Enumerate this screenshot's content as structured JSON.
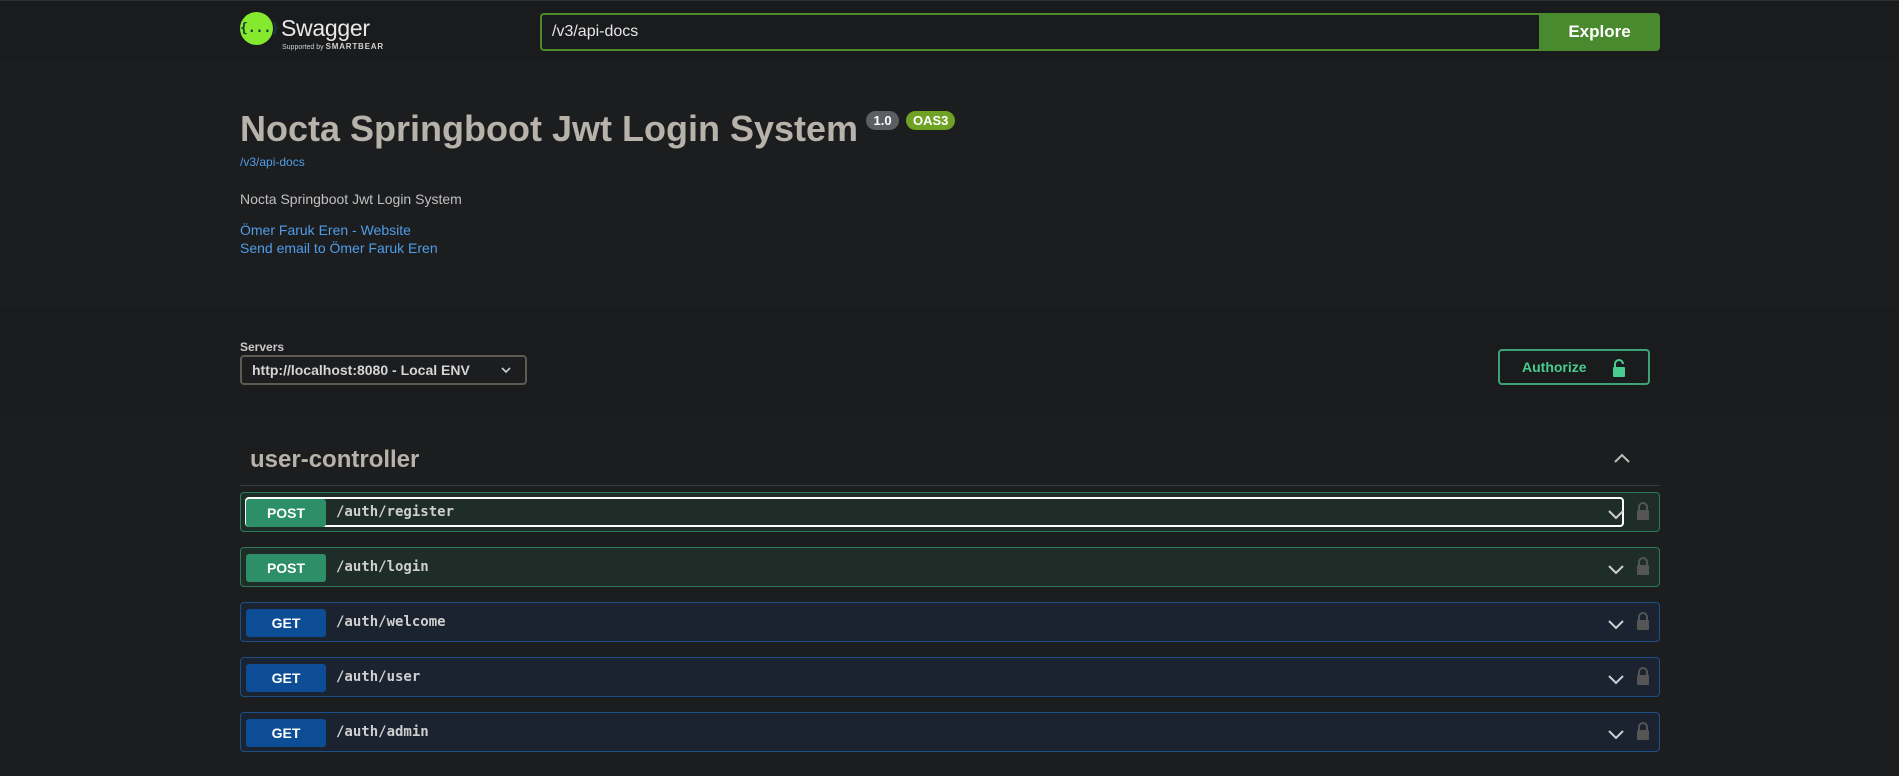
{
  "topbar": {
    "logo_text": "Swagger",
    "logo_glyph": "{...}",
    "logo_sub_prefix": "Supported by",
    "logo_sub_brand": "SMARTBEAR",
    "url_value": "/v3/api-docs",
    "explore_label": "Explore"
  },
  "info": {
    "title": "Nocta Springboot Jwt Login System",
    "version": "1.0",
    "oas_badge": "OAS3",
    "spec_link": "/v3/api-docs",
    "description": "Nocta Springboot Jwt Login System",
    "contact_website": "Ömer Faruk Eren - Website",
    "contact_email": "Send email to Ömer Faruk Eren"
  },
  "servers": {
    "label": "Servers",
    "selected": "http://localhost:8080 - Local ENV"
  },
  "authorize": {
    "label": "Authorize"
  },
  "section": {
    "title": "user-controller",
    "operations": [
      {
        "method": "POST",
        "path": "/auth/register"
      },
      {
        "method": "POST",
        "path": "/auth/login"
      },
      {
        "method": "GET",
        "path": "/auth/welcome"
      },
      {
        "method": "GET",
        "path": "/auth/user"
      },
      {
        "method": "GET",
        "path": "/auth/admin"
      }
    ]
  },
  "colors": {
    "post": "#49cc90",
    "get": "#0d4d95",
    "accent": "#85ea2d"
  },
  "icons": [
    "swagger-logo-icon",
    "chevron-down-icon",
    "chevron-up-icon",
    "lock-icon",
    "unlock-icon"
  ]
}
